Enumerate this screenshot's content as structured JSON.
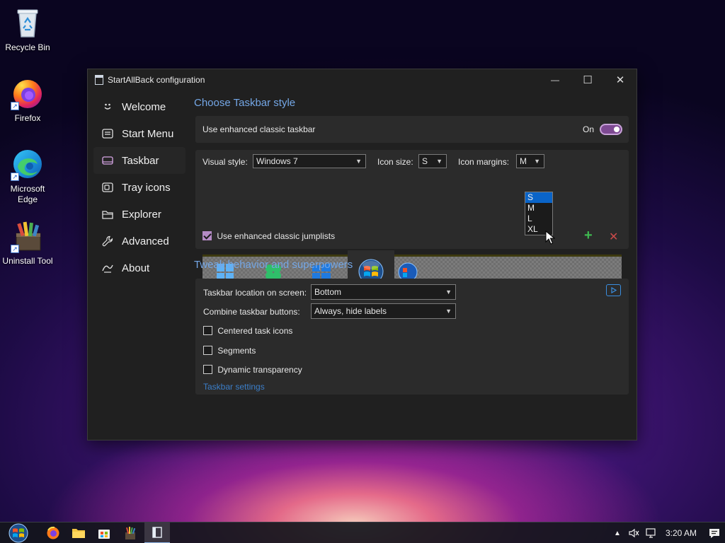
{
  "desktop": {
    "icons": [
      {
        "label": "Recycle Bin"
      },
      {
        "label": "Firefox"
      },
      {
        "label": "Microsoft Edge"
      },
      {
        "label": "Uninstall Tool"
      }
    ]
  },
  "window": {
    "title": "StartAllBack configuration",
    "controls": {
      "minimize": "—",
      "maximize": "☐",
      "close": "✕"
    }
  },
  "sidebar": {
    "items": [
      {
        "label": "Welcome",
        "icon": "smile-icon"
      },
      {
        "label": "Start Menu",
        "icon": "start-menu-icon"
      },
      {
        "label": "Taskbar",
        "icon": "taskbar-icon"
      },
      {
        "label": "Tray icons",
        "icon": "tray-icon"
      },
      {
        "label": "Explorer",
        "icon": "folder-icon"
      },
      {
        "label": "Advanced",
        "icon": "wrench-icon"
      },
      {
        "label": "About",
        "icon": "about-icon"
      }
    ],
    "active_index": 2
  },
  "taskbar_style": {
    "section_title": "Choose Taskbar style",
    "enhanced_label": "Use enhanced classic taskbar",
    "toggle_state": "On",
    "visual_style_label": "Visual style:",
    "visual_style_value": "Windows 7",
    "icon_size_label": "Icon size:",
    "icon_size_value": "S",
    "icon_size_options": [
      "S",
      "M",
      "L",
      "XL"
    ],
    "icon_margins_label": "Icon margins:",
    "icon_margins_value": "M",
    "jumplists_label": "Use enhanced classic jumplists",
    "jumplists_checked": true,
    "add_symbol": "+",
    "remove_symbol": "✕"
  },
  "tweak": {
    "section_title": "Tweak behavior and superpowers",
    "location_label": "Taskbar location on screen:",
    "location_value": "Bottom",
    "combine_label": "Combine taskbar buttons:",
    "combine_value": "Always, hide labels",
    "centered_label": "Centered task icons",
    "segments_label": "Segments",
    "dynamic_label": "Dynamic transparency",
    "settings_link": "Taskbar settings"
  },
  "taskbar": {
    "clock": "3:20 AM"
  },
  "colors": {
    "accent": "#74a7e6",
    "toggle": "#7e4a93",
    "selection": "#0a64c8"
  }
}
